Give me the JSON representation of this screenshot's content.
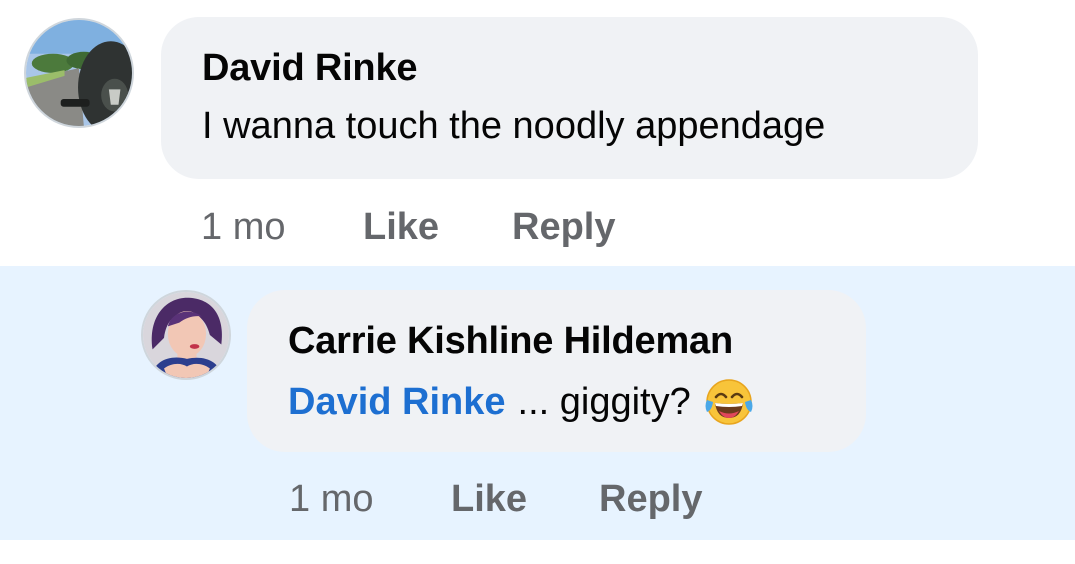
{
  "comments": [
    {
      "author": "David Rinke",
      "text": "I wanna touch the noodly appendage",
      "time": "1 mo",
      "like_label": "Like",
      "reply_label": "Reply"
    },
    {
      "author": "Carrie Kishline Hildeman",
      "mention": "David Rinke",
      "text": "... giggity?",
      "emoji": "face-with-tears-of-joy",
      "time": "1 mo",
      "like_label": "Like",
      "reply_label": "Reply"
    }
  ],
  "colors": {
    "bubble": "#f0f2f5",
    "highlight": "#e7f3ff",
    "mention": "#1d6fd1",
    "meta": "#65676b"
  }
}
